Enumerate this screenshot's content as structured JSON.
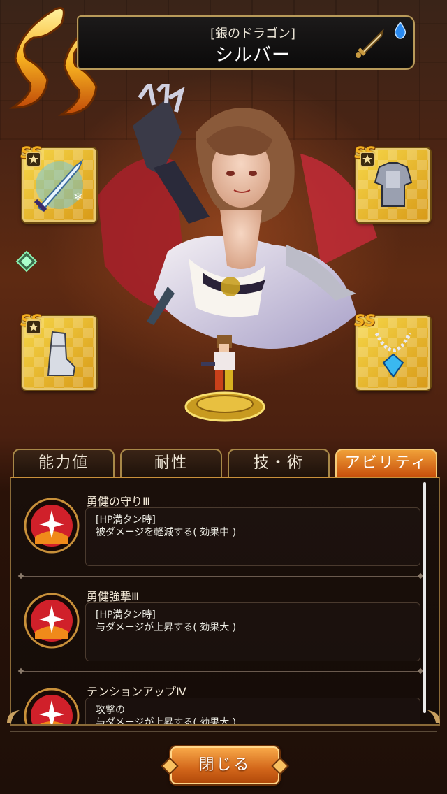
{
  "header": {
    "title_sub": "[銀のドラゴン]",
    "title_name": "シルバー"
  },
  "rank_badge": "SS",
  "icons": {
    "weapon_type": "sword-icon",
    "element": "water-drop-icon"
  },
  "equipment": [
    {
      "slot": "weapon",
      "icon": "ice-sword-icon",
      "badge": "SS"
    },
    {
      "slot": "armor",
      "icon": "plate-armor-icon",
      "badge": "SS"
    },
    {
      "slot": "boots",
      "icon": "greaves-icon",
      "badge": "SS"
    },
    {
      "slot": "accessory",
      "icon": "sapphire-necklace-icon",
      "badge": "SS"
    }
  ],
  "tabs": [
    {
      "label": "能力値",
      "active": false
    },
    {
      "label": "耐性",
      "active": false
    },
    {
      "label": "技・術",
      "active": false
    },
    {
      "label": "アビリティ",
      "active": true
    }
  ],
  "abilities": [
    {
      "name": "勇健の守りⅢ",
      "condition": "[HP満タン時]",
      "effect": "被ダメージを軽減する( 効果中 )"
    },
    {
      "name": "勇健強撃Ⅲ",
      "condition": "[HP満タン時]",
      "effect": "与ダメージが上昇する( 効果大 )"
    },
    {
      "name": "テンションアップⅣ",
      "condition": "攻撃の",
      "effect": "与ダメージが上昇する( 効果大 )"
    }
  ],
  "close_button": "閉じる",
  "colors": {
    "active_tab": "#e07a20",
    "gold_frame": "#e8c870",
    "panel_bg": "#1a0f0a"
  }
}
